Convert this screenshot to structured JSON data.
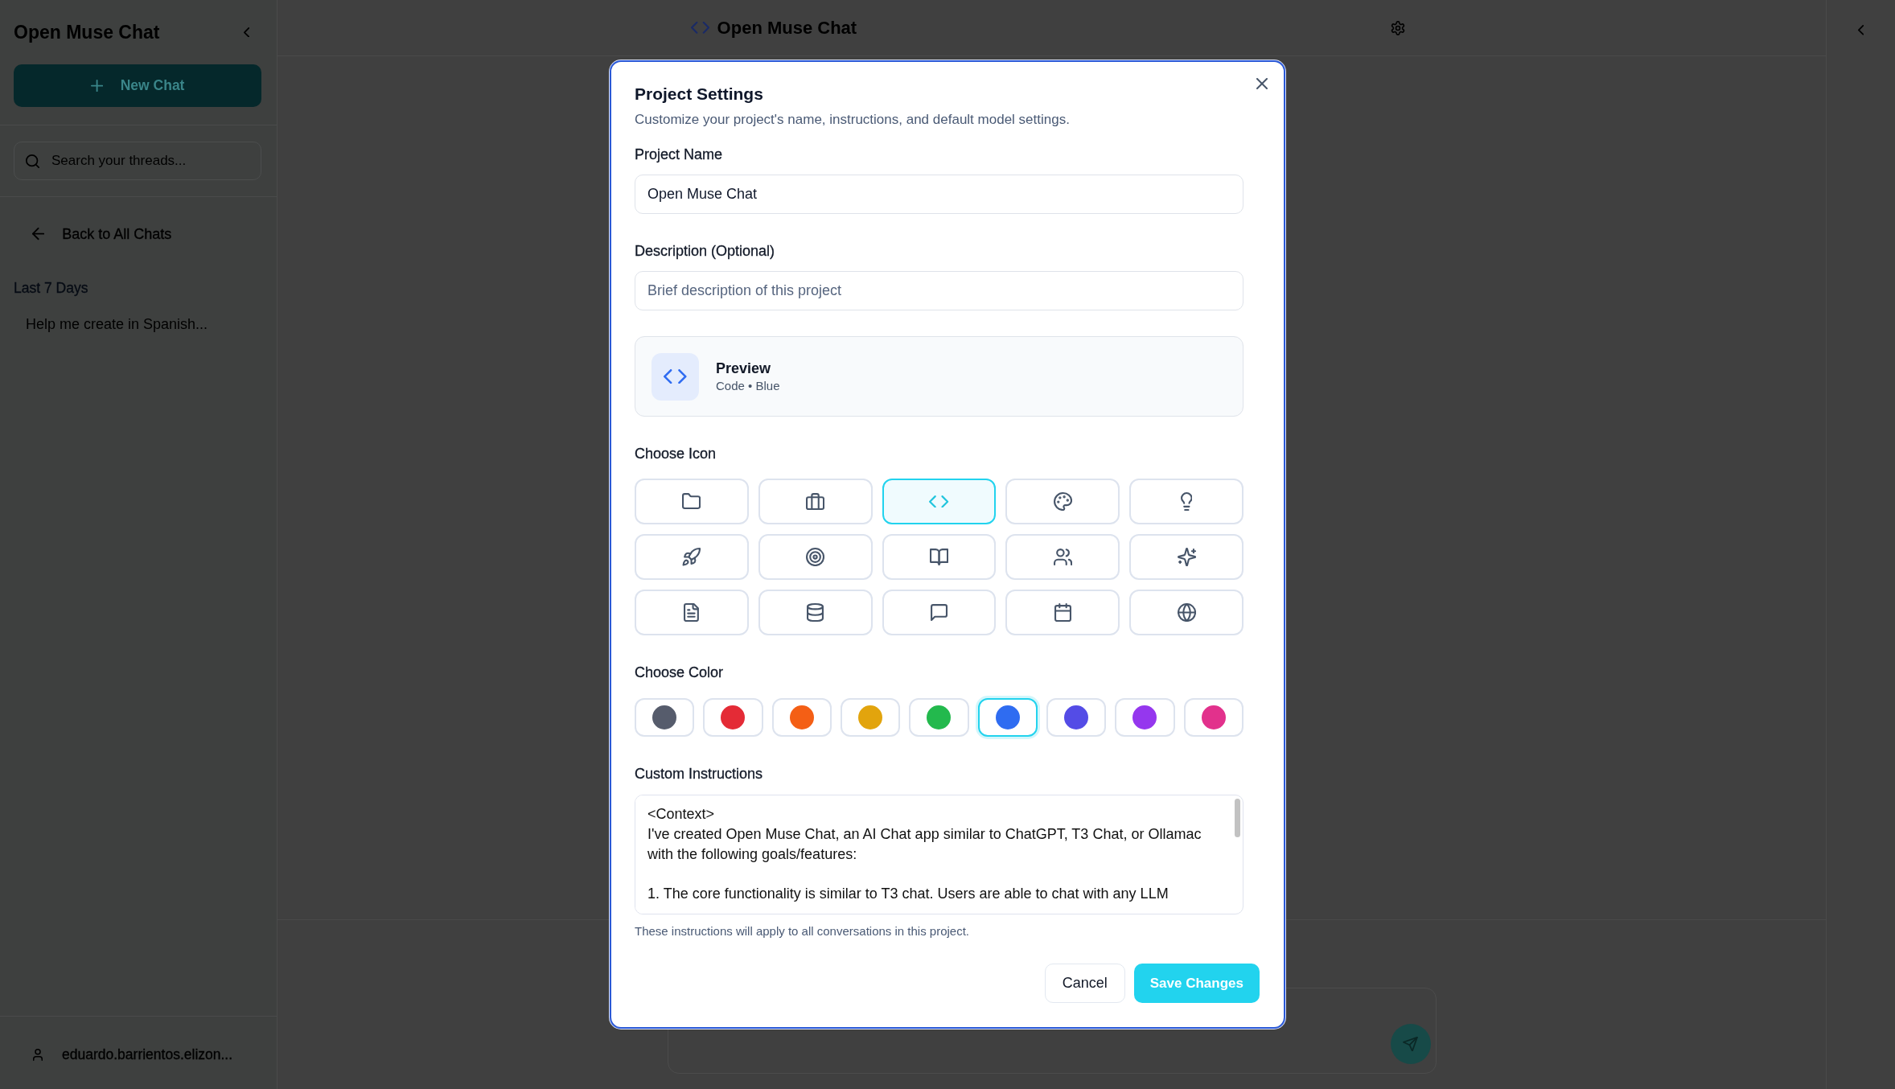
{
  "sidebar": {
    "title": "Open Muse Chat",
    "new_chat_button": "New Chat",
    "search": {
      "placeholder": "Search your threads..."
    },
    "back_link": "Back to All Chats",
    "groups": [
      {
        "heading": "Last 7 Days",
        "threads": [
          "Help me create in Spanish..."
        ]
      }
    ],
    "user": "eduardo.barrientos.elizon..."
  },
  "header": {
    "title": "Open Muse Chat"
  },
  "dialog": {
    "title": "Project Settings",
    "description": "Customize your project's name, instructions, and default model settings.",
    "name_field": {
      "label": "Project Name",
      "value": "Open Muse Chat"
    },
    "description_field": {
      "label": "Description (Optional)",
      "placeholder": "Brief description of this project"
    },
    "preview": {
      "title": "Preview",
      "caption": "Code • Blue"
    },
    "icon_picker": {
      "label": "Choose Icon",
      "options": [
        {
          "kind": "folder",
          "selected": false
        },
        {
          "kind": "briefcase",
          "selected": false
        },
        {
          "kind": "code",
          "selected": true
        },
        {
          "kind": "palette",
          "selected": false
        },
        {
          "kind": "lightbulb",
          "selected": false
        },
        {
          "kind": "rocket",
          "selected": false
        },
        {
          "kind": "target",
          "selected": false
        },
        {
          "kind": "book",
          "selected": false
        },
        {
          "kind": "users",
          "selected": false
        },
        {
          "kind": "sparkles",
          "selected": false
        },
        {
          "kind": "document",
          "selected": false
        },
        {
          "kind": "database",
          "selected": false
        },
        {
          "kind": "chat",
          "selected": false
        },
        {
          "kind": "calendar",
          "selected": false
        },
        {
          "kind": "globe",
          "selected": false
        }
      ]
    },
    "color_picker": {
      "label": "Choose Color",
      "options": [
        {
          "color": "#565c6c",
          "selected": false
        },
        {
          "color": "#e42b36",
          "selected": false
        },
        {
          "color": "#f45f15",
          "selected": false
        },
        {
          "color": "#e2a40d",
          "selected": false
        },
        {
          "color": "#23b94d",
          "selected": false
        },
        {
          "color": "#2f6cf1",
          "selected": true
        },
        {
          "color": "#544ce6",
          "selected": false
        },
        {
          "color": "#9537ee",
          "selected": false
        },
        {
          "color": "#e2318c",
          "selected": false
        }
      ]
    },
    "instructions": {
      "label": "Custom Instructions",
      "value": "<Context>\nI've created Open Muse Chat, an AI Chat app similar to ChatGPT, T3 Chat, or Ollamac with the following goals/features:\n\n1. The core functionality is similar to T3 chat. Users are able to chat with any LLM",
      "hint": "These instructions will apply to all conversations in this project."
    },
    "buttons": [
      {
        "label": "Cancel",
        "kind": "secondary"
      },
      {
        "label": "Save Changes",
        "kind": "primary"
      }
    ]
  }
}
